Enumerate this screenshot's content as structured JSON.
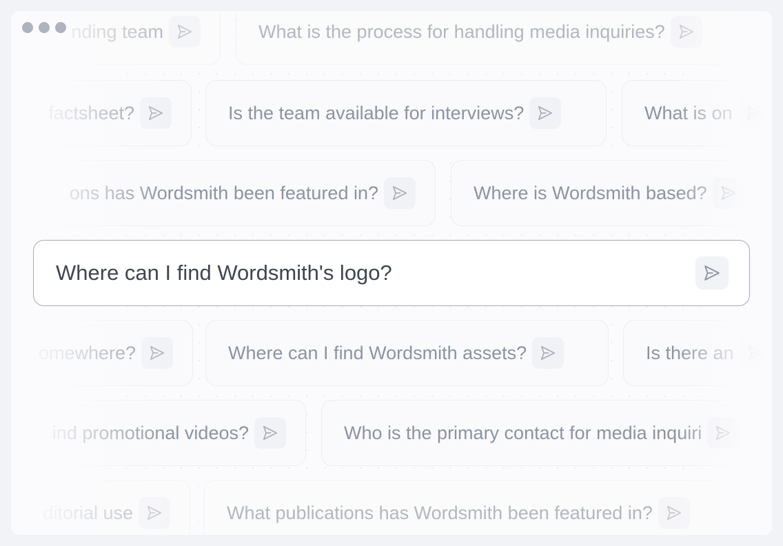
{
  "colors": {
    "window_dots": "#aeb3c0",
    "send_icon": "#a9aebb",
    "main_send_icon": "#8d93a2"
  },
  "icons": {
    "window_control": "dot-icon",
    "send": "send-icon"
  },
  "suggestions": [
    [
      "nding team",
      "What is the process for handling media inquiries?"
    ],
    [
      "factsheet?",
      "Is the team available for interviews?",
      "What is on"
    ],
    [
      "ons has Wordsmith been featured in?",
      "Where is Wordsmith based?"
    ],
    [
      "omewhere?",
      "Where can I find Wordsmith assets?",
      "Is there an"
    ],
    [
      "ind promotional videos?",
      "Who is the primary contact for media inquiri"
    ],
    [
      "ditorial use",
      "What publications has Wordsmith been featured in?"
    ]
  ],
  "main_input": {
    "value": "Where can I find Wordsmith's logo?"
  }
}
